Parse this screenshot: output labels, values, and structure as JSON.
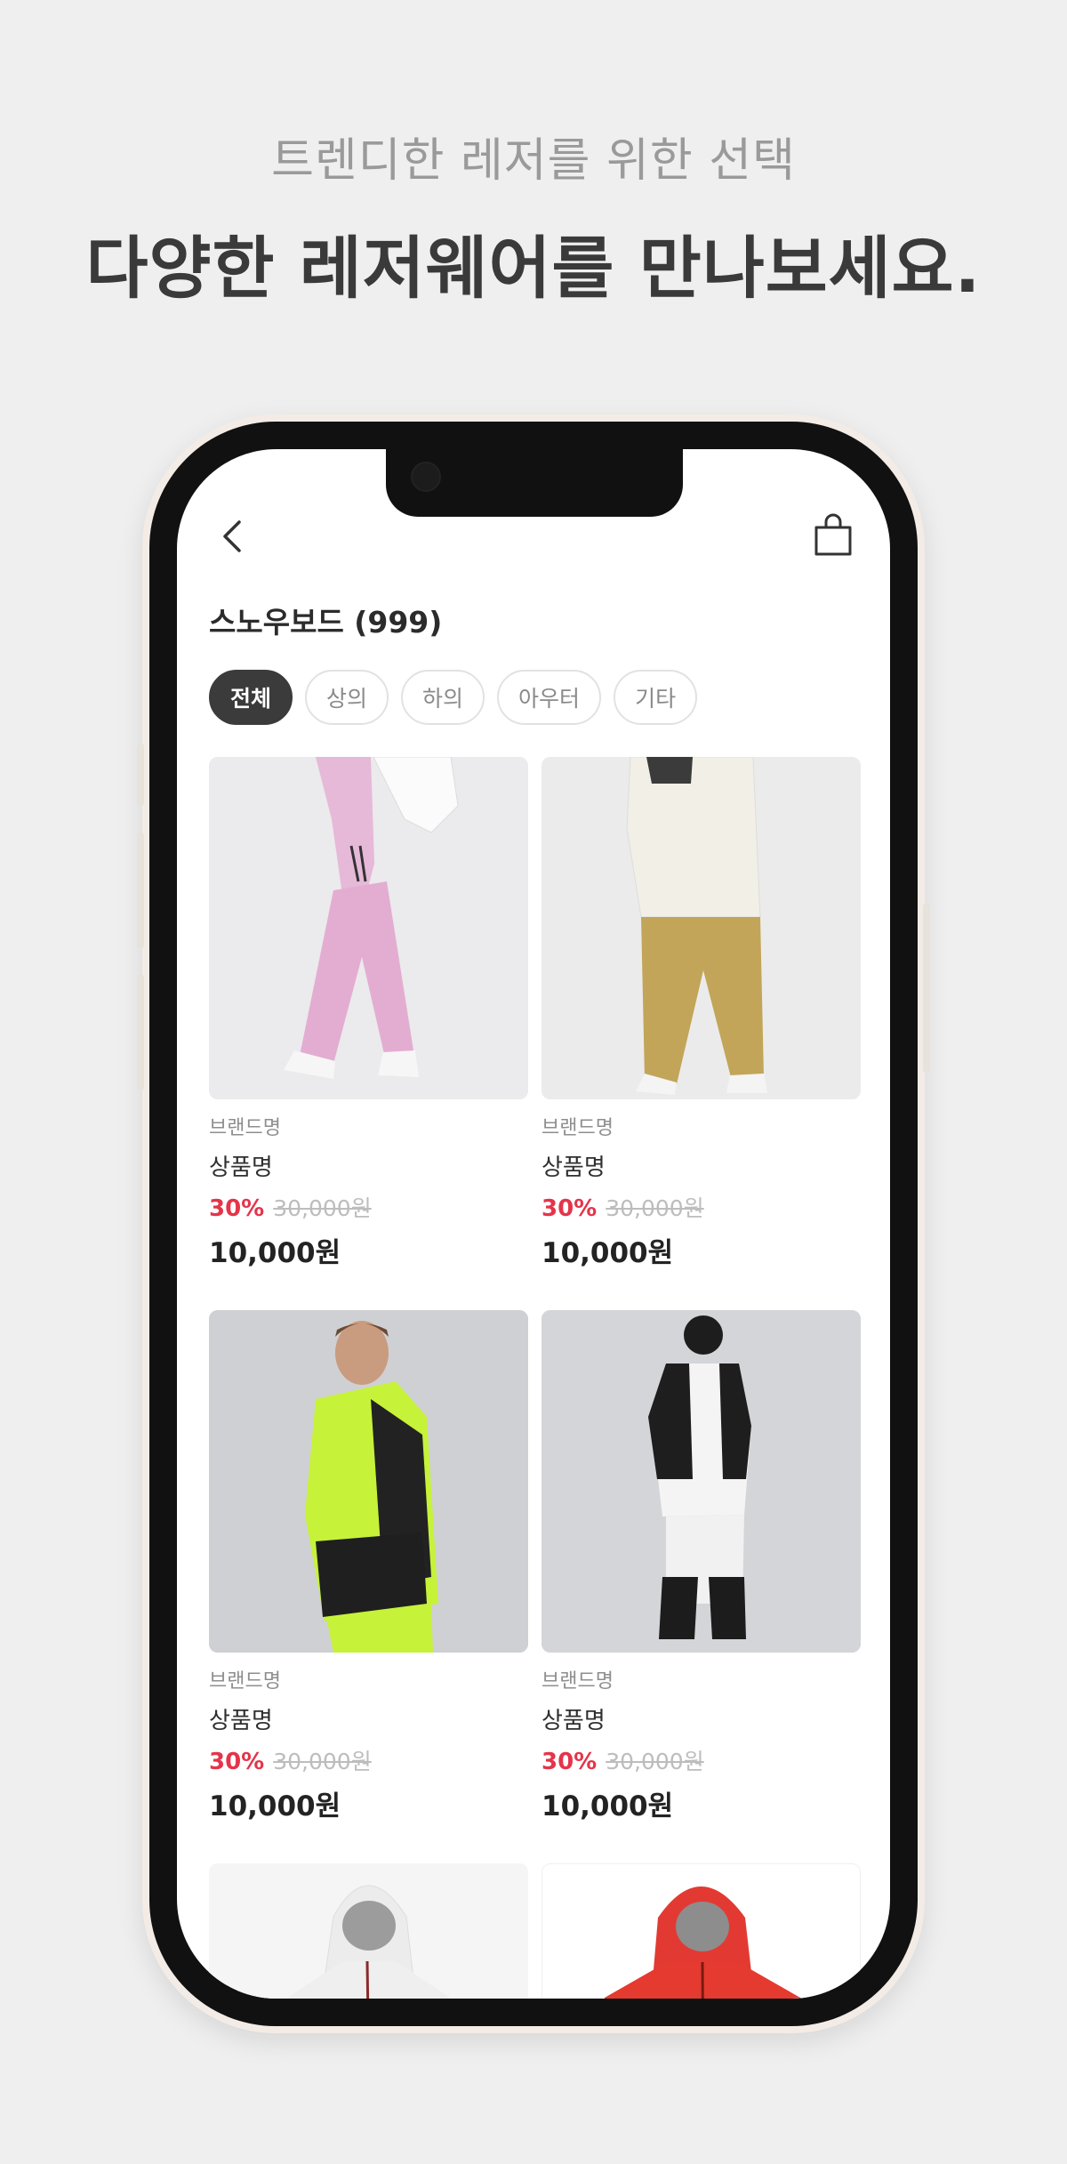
{
  "promo": {
    "subtitle": "트렌디한 레저를 위한 선택",
    "title": "다양한 레저웨어를 만나보세요."
  },
  "app": {
    "category_title": "스노우보드 (999)",
    "icons": {
      "back": "chevron-left-icon",
      "bag": "shopping-bag-icon"
    },
    "filters": [
      {
        "label": "전체",
        "selected": true
      },
      {
        "label": "상의",
        "selected": false
      },
      {
        "label": "하의",
        "selected": false
      },
      {
        "label": "아우터",
        "selected": false
      },
      {
        "label": "기타",
        "selected": false
      }
    ],
    "products": [
      {
        "brand": "브랜드명",
        "name": "상품명",
        "discount": "30%",
        "original_price": "30,000원",
        "price": "10,000원",
        "image": "pink snowboard overalls"
      },
      {
        "brand": "브랜드명",
        "name": "상품명",
        "discount": "30%",
        "original_price": "30,000원",
        "price": "10,000원",
        "image": "white jacket with khaki pants"
      },
      {
        "brand": "브랜드명",
        "name": "상품명",
        "discount": "30%",
        "original_price": "30,000원",
        "price": "10,000원",
        "image": "lime and black snowboard jacket"
      },
      {
        "brand": "브랜드명",
        "name": "상품명",
        "discount": "30%",
        "original_price": "30,000원",
        "price": "10,000원",
        "image": "black and white snowboard suit"
      }
    ],
    "partial_products": [
      {
        "image": "white hooded jacket"
      },
      {
        "image": "red hooded jacket"
      }
    ]
  },
  "colors": {
    "discount": "#e5344a",
    "selected_chip": "#3b3b3b",
    "page_background": "#efefef",
    "phone_shell": "#f3ece6"
  }
}
